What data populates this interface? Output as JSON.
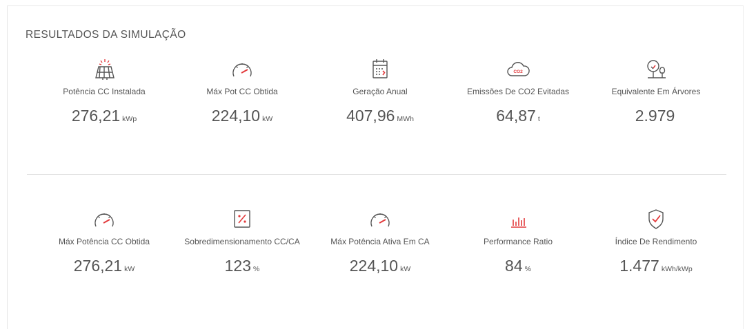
{
  "title": "RESULTADOS DA SIMULAÇÃO",
  "row1": [
    {
      "icon": "solar-panel-icon",
      "label": "Potência CC Instalada",
      "value": "276,21",
      "unit": "kWp"
    },
    {
      "icon": "gauge-icon",
      "label": "Máx Pot CC Obtida",
      "value": "224,10",
      "unit": "kW"
    },
    {
      "icon": "calendar-icon",
      "label": "Geração Anual",
      "value": "407,96",
      "unit": "MWh"
    },
    {
      "icon": "co2-cloud-icon",
      "label": "Emissões De CO2 Evitadas",
      "value": "64,87",
      "unit": "t"
    },
    {
      "icon": "trees-icon",
      "label": "Equivalente Em Árvores",
      "value": "2.979",
      "unit": ""
    }
  ],
  "row2": [
    {
      "icon": "gauge-icon",
      "label": "Máx Potência CC Obtida",
      "value": "276,21",
      "unit": "kW"
    },
    {
      "icon": "percent-box-icon",
      "label": "Sobredimensionamento CC/CA",
      "value": "123",
      "unit": "%"
    },
    {
      "icon": "gauge-icon",
      "label": "Máx Potência Ativa Em CA",
      "value": "224,10",
      "unit": "kW"
    },
    {
      "icon": "bar-chart-icon",
      "label": "Performance Ratio",
      "value": "84",
      "unit": "%"
    },
    {
      "icon": "shield-check-icon",
      "label": "Índice De Rendimento",
      "value": "1.477",
      "unit": "kWh/kWp"
    }
  ],
  "colors": {
    "accent": "#e2393b",
    "icon_stroke": "#555555",
    "text": "#555555"
  }
}
